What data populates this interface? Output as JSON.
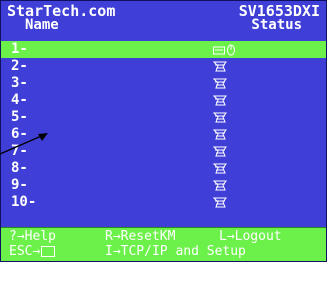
{
  "header": {
    "brand": "StarTech.com",
    "model": "SV1653DXI"
  },
  "columns": {
    "name": "Name",
    "status": "Status"
  },
  "ports": [
    {
      "label": "1-",
      "status_icon": "keyboard-mouse-icon",
      "selected": true
    },
    {
      "label": "2-",
      "status_icon": "port-status-icon",
      "selected": false
    },
    {
      "label": "3-",
      "status_icon": "port-status-icon",
      "selected": false
    },
    {
      "label": "4-",
      "status_icon": "port-status-icon",
      "selected": false
    },
    {
      "label": "5-",
      "status_icon": "port-status-icon",
      "selected": false
    },
    {
      "label": "6-",
      "status_icon": "port-status-icon",
      "selected": false
    },
    {
      "label": "7-",
      "status_icon": "port-status-icon",
      "selected": false
    },
    {
      "label": "8-",
      "status_icon": "port-status-icon",
      "selected": false
    },
    {
      "label": "9-",
      "status_icon": "port-status-icon",
      "selected": false
    },
    {
      "label": "10-",
      "status_icon": "port-status-icon",
      "selected": false
    }
  ],
  "footer": {
    "help": "?→Help",
    "reset_km": "R→ResetKM",
    "logout": "L→Logout",
    "esc": "ESC→",
    "tcpip": "I→TCP/IP and Setup"
  },
  "colors": {
    "background": "#3f3fd8",
    "highlight": "#6cf04a",
    "text": "#ffffff"
  }
}
